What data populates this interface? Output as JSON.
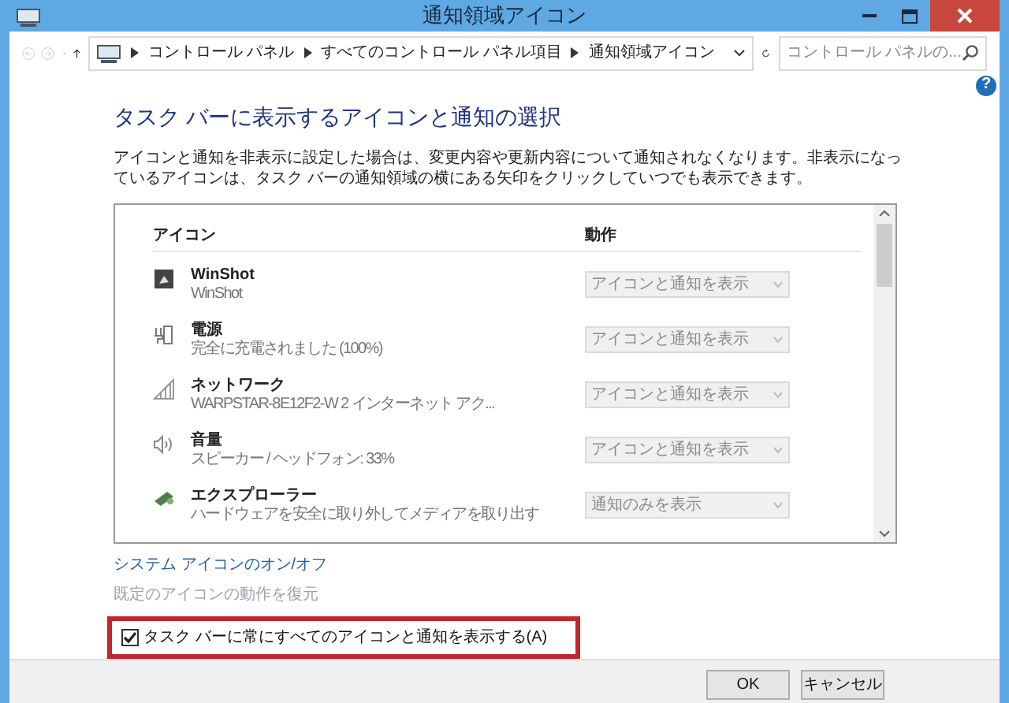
{
  "window": {
    "title": "通知領域アイコン"
  },
  "address_bar": {
    "breadcrumbs": [
      "コントロール パネル",
      "すべてのコントロール パネル項目",
      "通知領域アイコン"
    ]
  },
  "search": {
    "placeholder": "コントロール パネルの..."
  },
  "help": "?",
  "heading": "タスク バーに表示するアイコンと通知の選択",
  "description": "アイコンと通知を非表示に設定した場合は、変更内容や更新内容について通知されなくなります。非表示になっているアイコンは、タスク バーの通知領域の横にある矢印をクリックしていつでも表示できます。",
  "table": {
    "columns": [
      "アイコン",
      "動作"
    ],
    "disabled": true,
    "rows": [
      {
        "kind": "app",
        "name": "WinShot",
        "detail": "WinShot",
        "action": "アイコンと通知を表示"
      },
      {
        "kind": "power",
        "name": "電源",
        "detail": "完全に充電されました (100%)",
        "action": "アイコンと通知を表示"
      },
      {
        "kind": "network",
        "name": "ネットワーク",
        "detail": "WARPSTAR-8E12F2-W  2 インターネット アク...",
        "action": "アイコンと通知を表示"
      },
      {
        "kind": "volume",
        "name": "音量",
        "detail": "スピーカー / ヘッドフォン: 33%",
        "action": "アイコンと通知を表示"
      },
      {
        "kind": "eject",
        "name": "エクスプローラー",
        "detail": "ハードウェアを安全に取り外してメディアを取り出す",
        "action": "通知のみを表示"
      }
    ]
  },
  "links": [
    {
      "label": "システム アイコンのオン/オフ",
      "disabled": false
    },
    {
      "label": "既定のアイコンの動作を復元",
      "disabled": true
    }
  ],
  "always_show": {
    "label": "タスク バーに常にすべてのアイコンと通知を表示する(A)",
    "checked": true
  },
  "buttons": [
    "OK",
    "キャンセル"
  ]
}
